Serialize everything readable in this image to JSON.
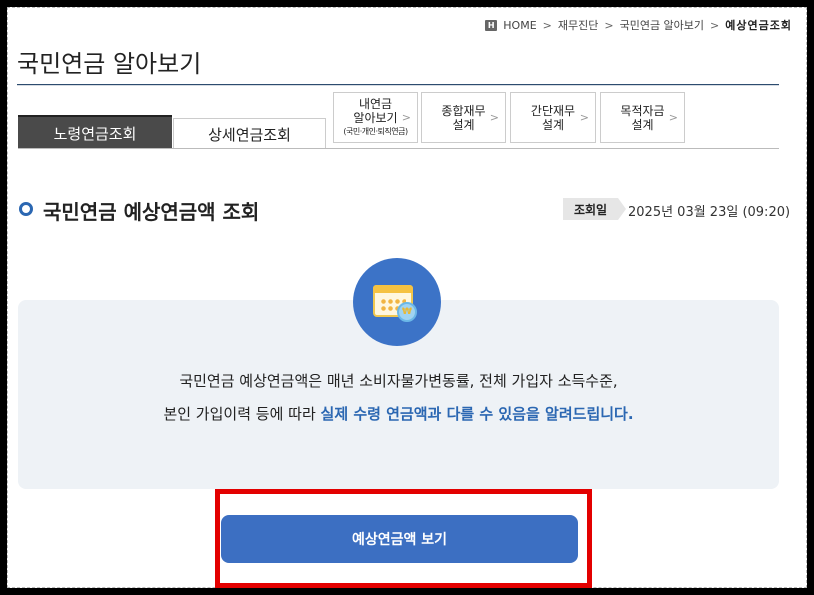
{
  "breadcrumb": {
    "home_badge": "H",
    "items": [
      "HOME",
      "재무진단",
      "국민연금 알아보기",
      "예상연금조회"
    ]
  },
  "page_title": "국민연금 알아보기",
  "tabs": {
    "active": "노령연금조회",
    "inactive": "상세연금조회"
  },
  "sub_tabs": [
    {
      "line1": "내연금",
      "line2": "알아보기",
      "line3": "(국민·개인·퇴직연금)"
    },
    {
      "line1": "종합재무",
      "line2": "설계"
    },
    {
      "line1": "간단재무",
      "line2": "설계"
    },
    {
      "line1": "목적자금",
      "line2": "설계"
    }
  ],
  "section": {
    "title": "국민연금 예상연금액 조회",
    "date_label": "조회일",
    "date_value": "2025년 03월 23일 (09:20)"
  },
  "info": {
    "coin_symbol": "₩",
    "line1": "국민연금 예상연금액은 매년 소비자물가변동률, 전체 가입자 소득수준,",
    "line2_plain": "본인 가입이력 등에 따라 ",
    "line2_highlight": "실제 수령 연금액과 다를 수 있음을 알려드립니다."
  },
  "button": {
    "label": "예상연금액 보기"
  },
  "colors": {
    "accent": "#3c6fc2",
    "highlight": "#2b67b2",
    "annotation": "#e30000"
  }
}
